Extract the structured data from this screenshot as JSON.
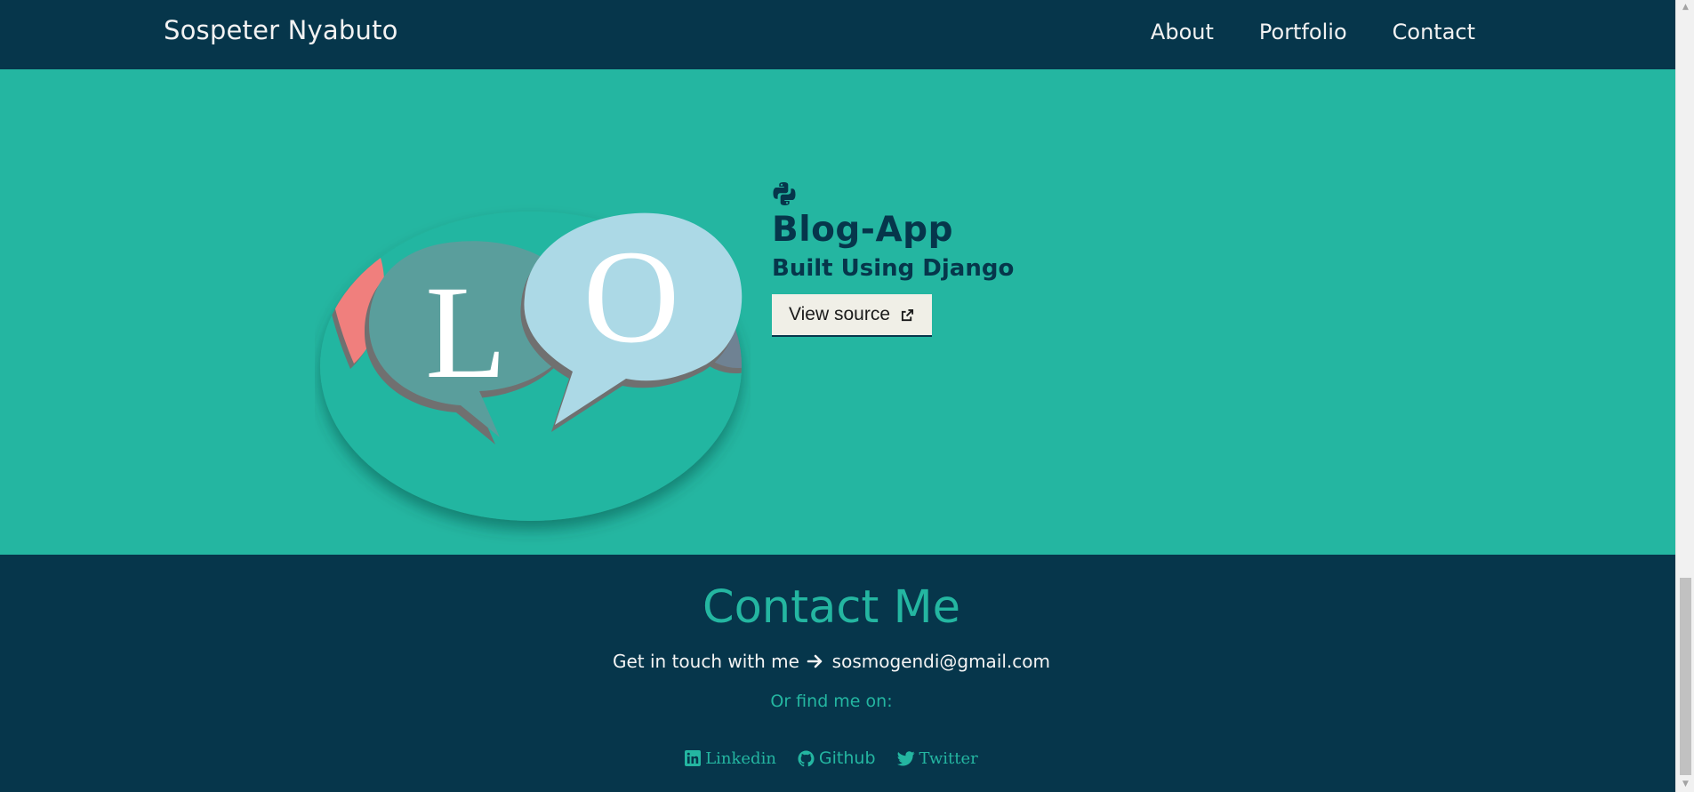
{
  "header": {
    "brand": "Sospeter Nyabuto",
    "nav": [
      "About",
      "Portfolio",
      "Contact"
    ]
  },
  "project": {
    "image_letters": [
      "L",
      "O"
    ],
    "language_icon": "python-icon",
    "title": "Blog-App",
    "subtitle": "Built Using Django",
    "button_label": "View source",
    "button_icon": "external-link-icon"
  },
  "footer": {
    "heading": "Contact Me",
    "contact_prefix": "Get in touch with me",
    "arrow_icon": "arrow-right-icon",
    "email": "sosmogendi@gmail.com",
    "find_me": "Or find me on:",
    "social": [
      {
        "label": "Linkedin",
        "icon": "linkedin-icon"
      },
      {
        "label": "Github",
        "icon": "github-icon"
      },
      {
        "label": "Twitter",
        "icon": "twitter-icon"
      }
    ]
  },
  "colors": {
    "navy": "#06364b",
    "teal": "#24b6a1",
    "button_bg": "#f0efe7"
  }
}
